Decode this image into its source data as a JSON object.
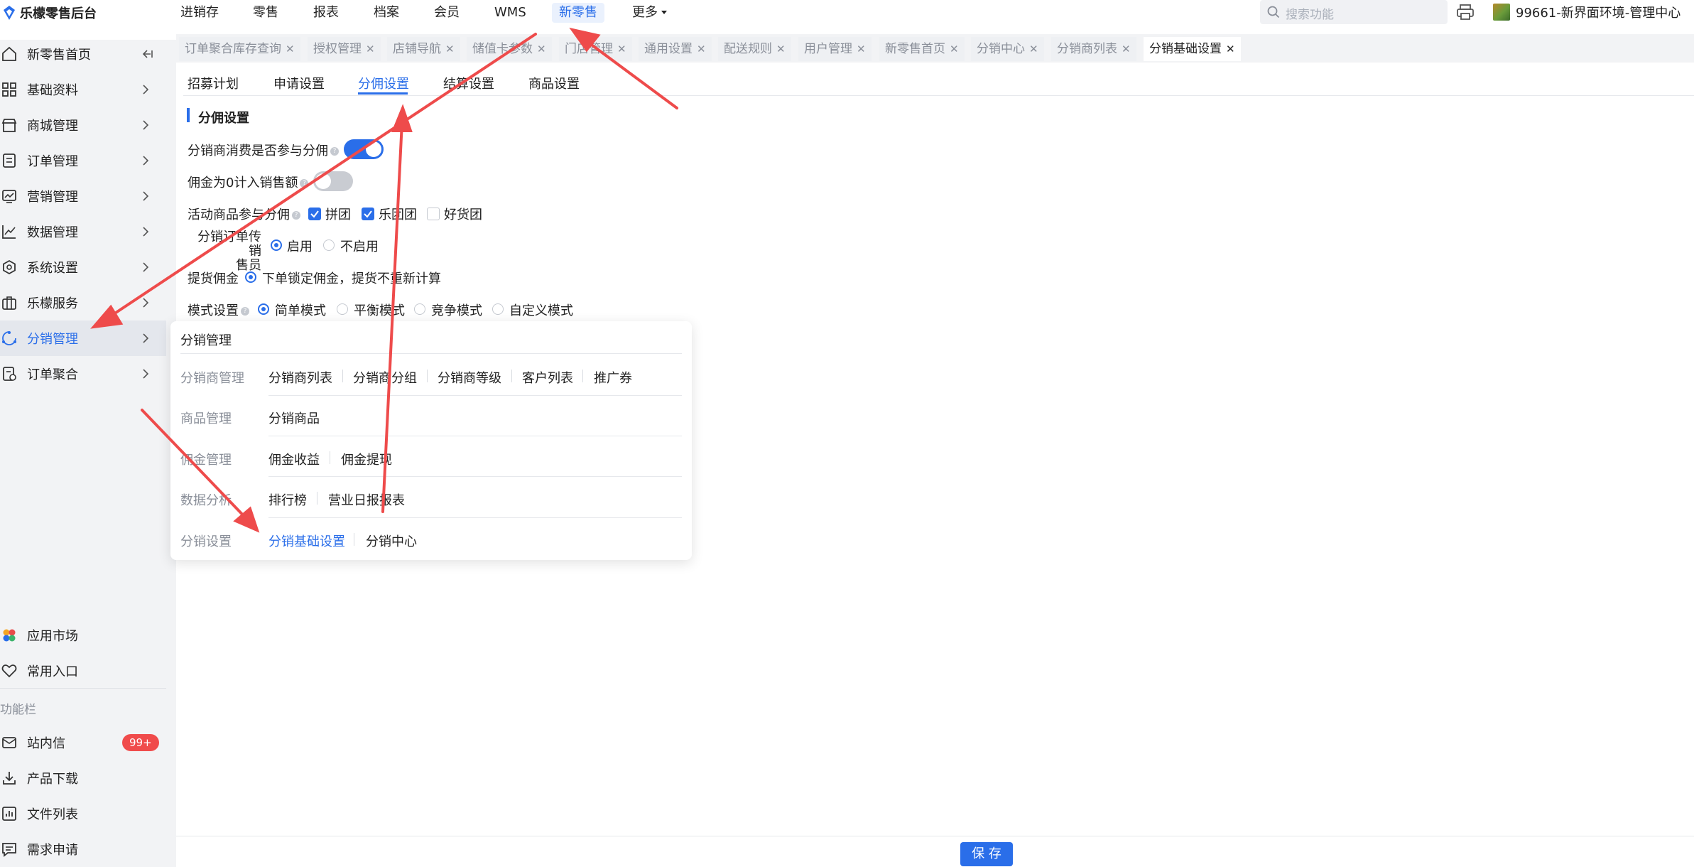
{
  "header": {
    "logo_text": "乐檬零售后台",
    "nav": [
      "进销存",
      "零售",
      "报表",
      "档案",
      "会员",
      "WMS",
      "新零售",
      "更多"
    ],
    "active_nav": "新零售",
    "search_placeholder": "搜索功能",
    "account": "99661-新界面环境-管理中心"
  },
  "sidebar": {
    "items": [
      {
        "label": "新零售首页",
        "icon": "home-icon"
      },
      {
        "label": "基础资料",
        "icon": "grid-icon"
      },
      {
        "label": "商城管理",
        "icon": "store-icon"
      },
      {
        "label": "订单管理",
        "icon": "order-icon"
      },
      {
        "label": "营销管理",
        "icon": "marketing-icon"
      },
      {
        "label": "数据管理",
        "icon": "chart-icon"
      },
      {
        "label": "系统设置",
        "icon": "settings-icon"
      },
      {
        "label": "乐檬服务",
        "icon": "service-icon"
      },
      {
        "label": "分销管理",
        "icon": "distribution-icon"
      },
      {
        "label": "订单聚合",
        "icon": "order-aggregate-icon"
      }
    ],
    "active": "分销管理",
    "bottom_items": [
      {
        "label": "应用市场",
        "icon": "app-market-icon"
      },
      {
        "label": "常用入口",
        "icon": "heart-icon"
      }
    ],
    "func_header": "功能栏",
    "func_items": [
      {
        "label": "站内信",
        "icon": "mail-icon"
      },
      {
        "label": "产品下载",
        "icon": "download-icon"
      },
      {
        "label": "文件列表",
        "icon": "file-list-icon"
      },
      {
        "label": "需求申请",
        "icon": "request-icon"
      }
    ],
    "badge": "99+"
  },
  "page_tabs": [
    "订单聚合库存查询",
    "授权管理",
    "店铺导航",
    "储值卡参数",
    "门店管理",
    "通用设置",
    "配送规则",
    "用户管理",
    "新零售首页",
    "分销中心",
    "分销商列表",
    "分销基础设置"
  ],
  "active_page_tab": "分销基础设置",
  "sub_tabs": [
    "招募计划",
    "申请设置",
    "分佣设置",
    "结算设置",
    "商品设置"
  ],
  "active_sub_tab": "分佣设置",
  "settings": {
    "section_title": "分佣设置",
    "consumer_commission_label": "分销商消费是否参与分佣",
    "consumer_commission_on": true,
    "zero_commission_label": "佣金为0计入销售额",
    "zero_commission_on": false,
    "activity_label": "活动商品参与分佣",
    "activity_options": [
      {
        "label": "拼团",
        "checked": true
      },
      {
        "label": "乐团团",
        "checked": true
      },
      {
        "label": "好货团",
        "checked": false
      }
    ],
    "order_pass_label_1": "分销订单传销",
    "order_pass_label_2": "售员",
    "order_pass_options": [
      {
        "label": "启用",
        "checked": true
      },
      {
        "label": "不启用",
        "checked": false
      }
    ],
    "pickup_label": "提货佣金",
    "pickup_option": "下单锁定佣金，提货不重新计算",
    "mode_label": "模式设置",
    "mode_options": [
      {
        "label": "简单模式",
        "checked": true
      },
      {
        "label": "平衡模式",
        "checked": false
      },
      {
        "label": "竞争模式",
        "checked": false
      },
      {
        "label": "自定义模式",
        "checked": false
      }
    ]
  },
  "popup": {
    "title": "分销管理",
    "groups": [
      {
        "name": "分销商管理",
        "links": [
          "分销商列表",
          "分销商分组",
          "分销商等级",
          "客户列表",
          "推广券"
        ]
      },
      {
        "name": "商品管理",
        "links": [
          "分销商品"
        ]
      },
      {
        "name": "佣金管理",
        "links": [
          "佣金收益",
          "佣金提现"
        ]
      },
      {
        "name": "数据分析",
        "links": [
          "排行榜",
          "营业日报报表"
        ]
      },
      {
        "name": "分销设置",
        "links": [
          "分销基础设置",
          "分销中心"
        ]
      }
    ],
    "active_link": "分销基础设置"
  },
  "footer": {
    "save_label": "保 存"
  },
  "colors": {
    "accent": "#2a6ee9",
    "annotation_arrow": "#ee4b4b",
    "badge": "#f04b4b"
  }
}
